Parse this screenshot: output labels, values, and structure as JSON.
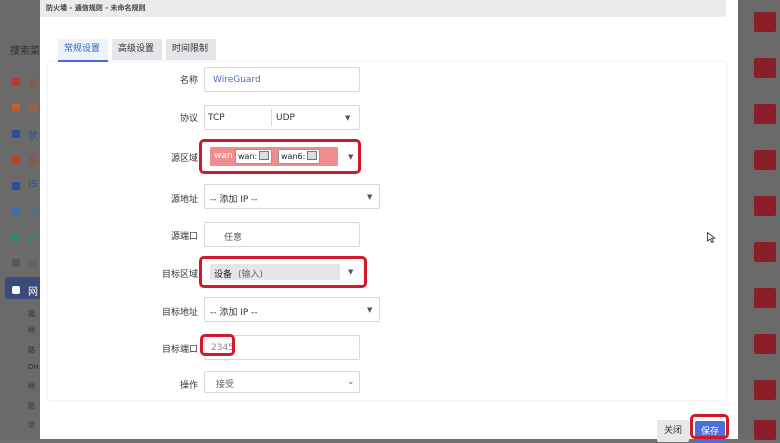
{
  "background": {
    "sidebar_items": [
      "搜索菜",
      "首",
      "网",
      "状",
      "系",
      "iS",
      "Do",
      "服",
      "网",
      "网",
      "接",
      "网",
      "路",
      "DH",
      "网",
      "防",
      "诊"
    ],
    "cursor": "mouse-pointer-icon"
  },
  "modal": {
    "title": "防火墙 - 通信规则 - 未命名规则",
    "tabs": [
      {
        "label": "常规设置",
        "active": true
      },
      {
        "label": "高级设置",
        "active": false
      },
      {
        "label": "时间限制",
        "active": false
      }
    ],
    "fields": {
      "name": {
        "label": "名称",
        "value": "WireGuard"
      },
      "protocol": {
        "label": "协议",
        "options": [
          "TCP",
          "UDP"
        ]
      },
      "src_zone": {
        "label": "源区域",
        "zone_name": "wan",
        "chips": [
          "wan:",
          "wan6:"
        ]
      },
      "src_addr": {
        "label": "源地址",
        "placeholder": "-- 添加 IP --"
      },
      "src_port": {
        "label": "源端口",
        "placeholder": "任意"
      },
      "dst_zone": {
        "label": "目标区域",
        "value": "设备",
        "hint": "(输入)"
      },
      "dst_addr": {
        "label": "目标地址",
        "placeholder": "-- 添加 IP --"
      },
      "dst_port": {
        "label": "目标端口",
        "value": "2345"
      },
      "action": {
        "label": "操作",
        "value": "接受"
      }
    },
    "buttons": {
      "close": "关闭",
      "save": "保存"
    }
  },
  "colors": {
    "accent": "#4a6fd8",
    "highlight_border": "#d0192b",
    "src_zone_fill": "#ef8c8c",
    "dst_zone_fill": "#e6e6e6"
  }
}
